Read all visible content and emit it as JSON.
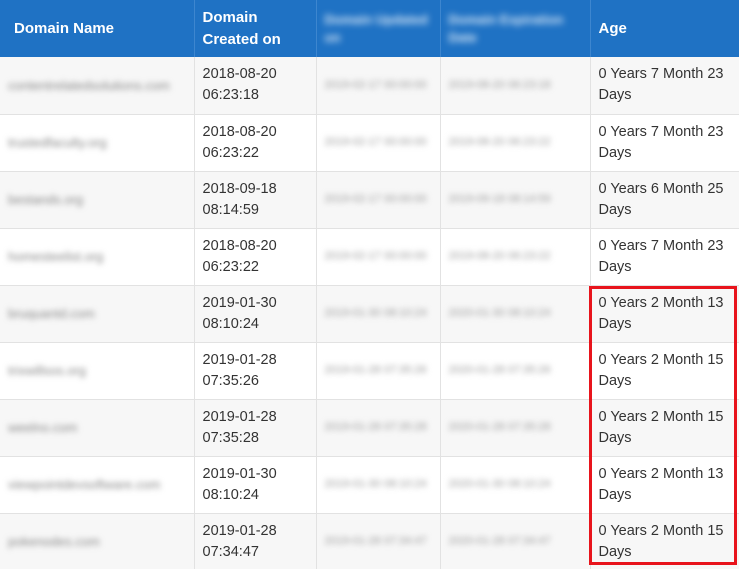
{
  "table": {
    "headers": {
      "domain_name": "Domain Name",
      "created_on": "Domain Created on",
      "updated_on": "Domain Updated on",
      "expiration_date": "Domain Expiration Date",
      "age": "Age"
    },
    "rows": [
      {
        "domain": "contentrelatedsolutions.com",
        "created": "2018-08-20 06:23:18",
        "updated": "2019-02-17 00:00:00",
        "expires": "2019-08-20 06:23:18",
        "age": "0 Years 7 Month 23 Days"
      },
      {
        "domain": "trustedfaculty.org",
        "created": "2018-08-20 06:23:22",
        "updated": "2019-02-17 00:00:00",
        "expires": "2019-08-20 06:23:22",
        "age": "0 Years 7 Month 23 Days"
      },
      {
        "domain": "bestands.org",
        "created": "2018-09-18 08:14:59",
        "updated": "2019-02-17 00:00:00",
        "expires": "2019-09-18 08:14:59",
        "age": "0 Years 6 Month 25 Days"
      },
      {
        "domain": "homesteelist.org",
        "created": "2018-08-20 06:23:22",
        "updated": "2019-02-17 00:00:00",
        "expires": "2019-08-20 06:23:22",
        "age": "0 Years 7 Month 23 Days"
      },
      {
        "domain": "bruquantd.com",
        "created": "2019-01-30 08:10:24",
        "updated": "2019-01-30 08:10:24",
        "expires": "2020-01-30 08:10:24",
        "age": "0 Years 2 Month 13 Days"
      },
      {
        "domain": "trixwillsos.org",
        "created": "2019-01-28 07:35:26",
        "updated": "2019-01-28 07:35:26",
        "expires": "2020-01-28 07:35:26",
        "age": "0 Years 2 Month 15 Days"
      },
      {
        "domain": "weelno.com",
        "created": "2019-01-28 07:35:28",
        "updated": "2019-01-28 07:35:28",
        "expires": "2020-01-28 07:35:28",
        "age": "0 Years 2 Month 15 Days"
      },
      {
        "domain": "viewpointdevsoftware.com",
        "created": "2019-01-30 08:10:24",
        "updated": "2019-01-30 08:10:24",
        "expires": "2020-01-30 08:10:24",
        "age": "0 Years 2 Month 13 Days"
      },
      {
        "domain": "pokenodes.com",
        "created": "2019-01-28 07:34:47",
        "updated": "2019-01-28 07:34:47",
        "expires": "2020-01-28 07:34:47",
        "age": "0 Years 2 Month 15 Days"
      }
    ]
  },
  "colors": {
    "header_bg": "#1f72c4",
    "highlight": "#e8141c"
  }
}
